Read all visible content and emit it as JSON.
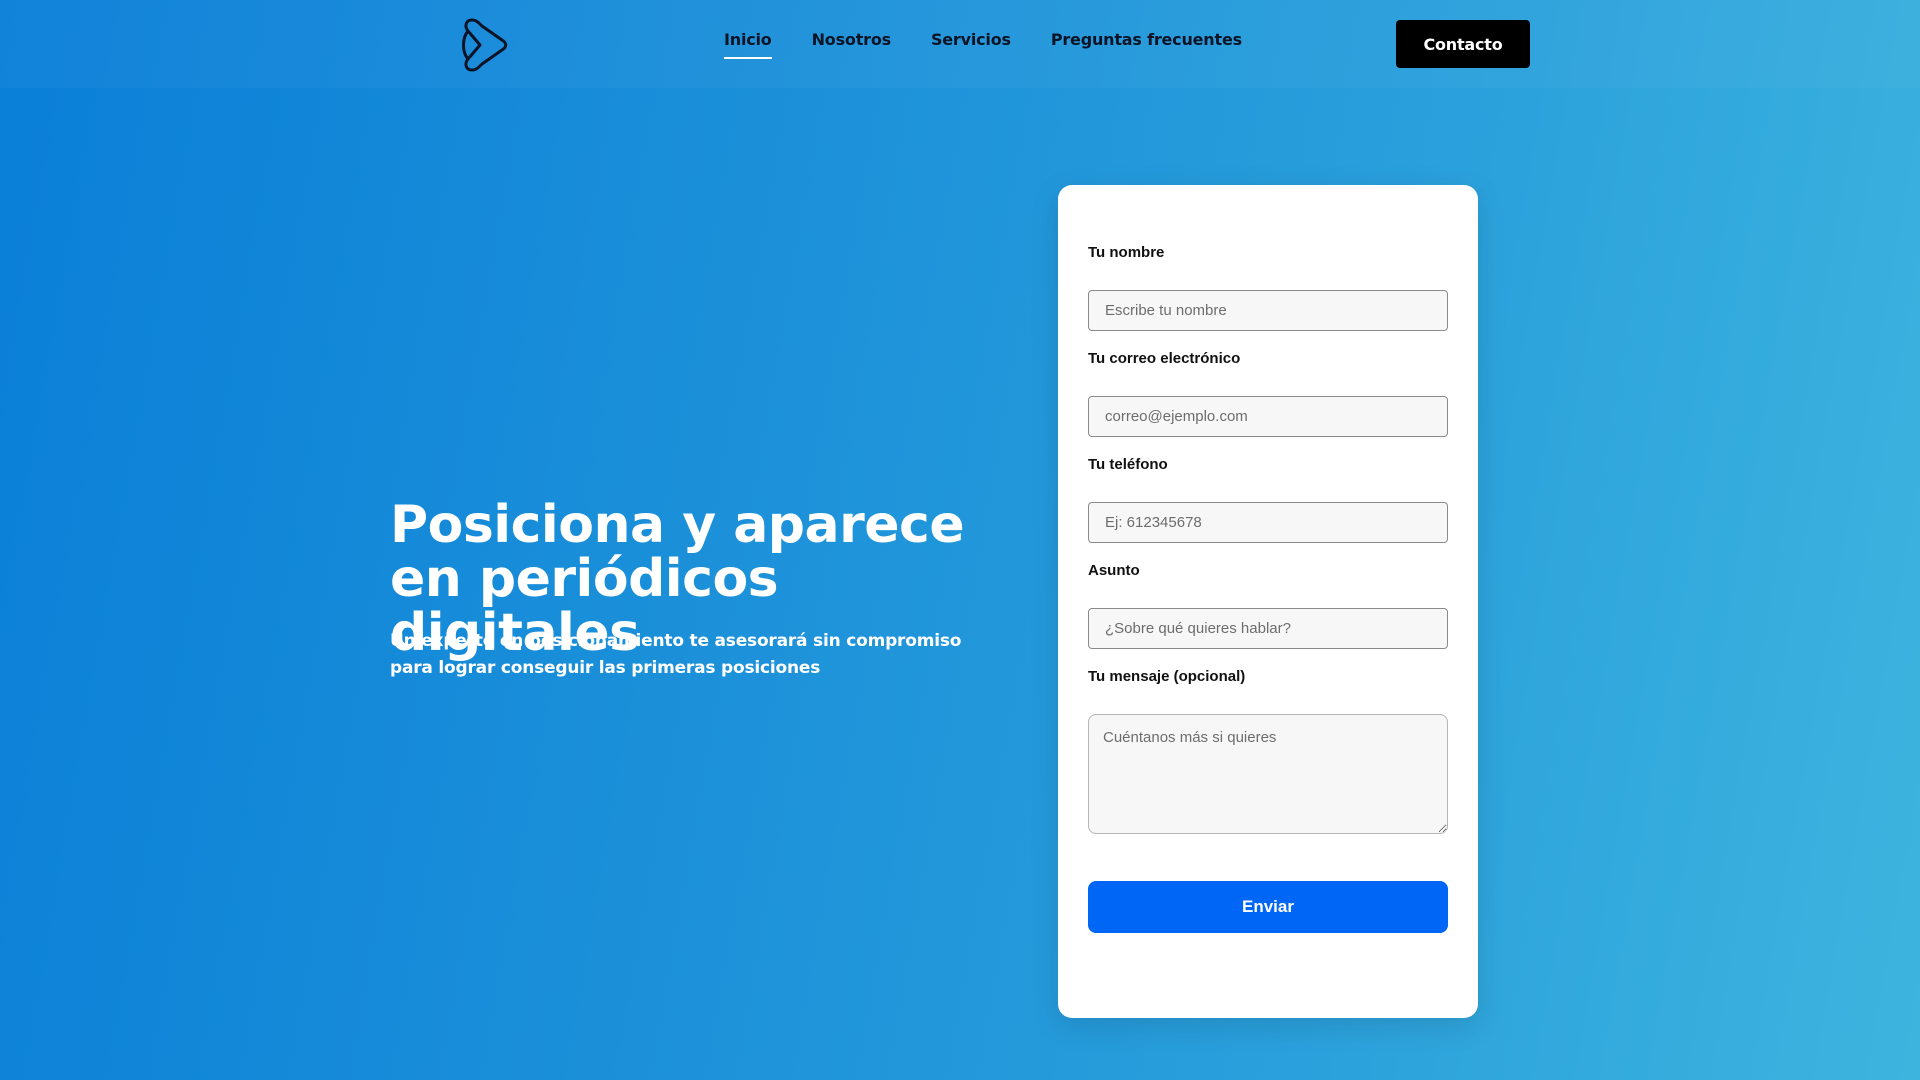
{
  "nav": {
    "logo_icon": "play-outline-logo-icon",
    "links": [
      {
        "label": "Inicio",
        "active": true
      },
      {
        "label": "Nosotros",
        "active": false
      },
      {
        "label": "Servicios",
        "active": false
      },
      {
        "label": "Preguntas frecuentes",
        "active": false
      }
    ],
    "contact_label": "Contacto"
  },
  "hero": {
    "title": "Posiciona y aparece en periódicos digitales",
    "subtitle": "Un experto en posicionamiento te asesorará sin compromiso para lograr conseguir las primeras posiciones"
  },
  "form": {
    "name": {
      "label": "Tu nombre",
      "placeholder": "Escribe tu nombre",
      "value": ""
    },
    "email": {
      "label": "Tu correo electrónico",
      "placeholder": "correo@ejemplo.com",
      "value": ""
    },
    "phone": {
      "label": "Tu teléfono",
      "placeholder": "Ej: 612345678",
      "value": ""
    },
    "subject": {
      "label": "Asunto",
      "placeholder": "¿Sobre qué quieres hablar?",
      "value": ""
    },
    "message": {
      "label": "Tu mensaje (opcional)",
      "placeholder": "Cuéntanos más si quieres",
      "value": ""
    },
    "submit_label": "Enviar"
  },
  "colors": {
    "accent": "#0066f5",
    "contact_button": "#000000",
    "background_start": "#0a7fd8",
    "background_end": "#3db4de"
  }
}
